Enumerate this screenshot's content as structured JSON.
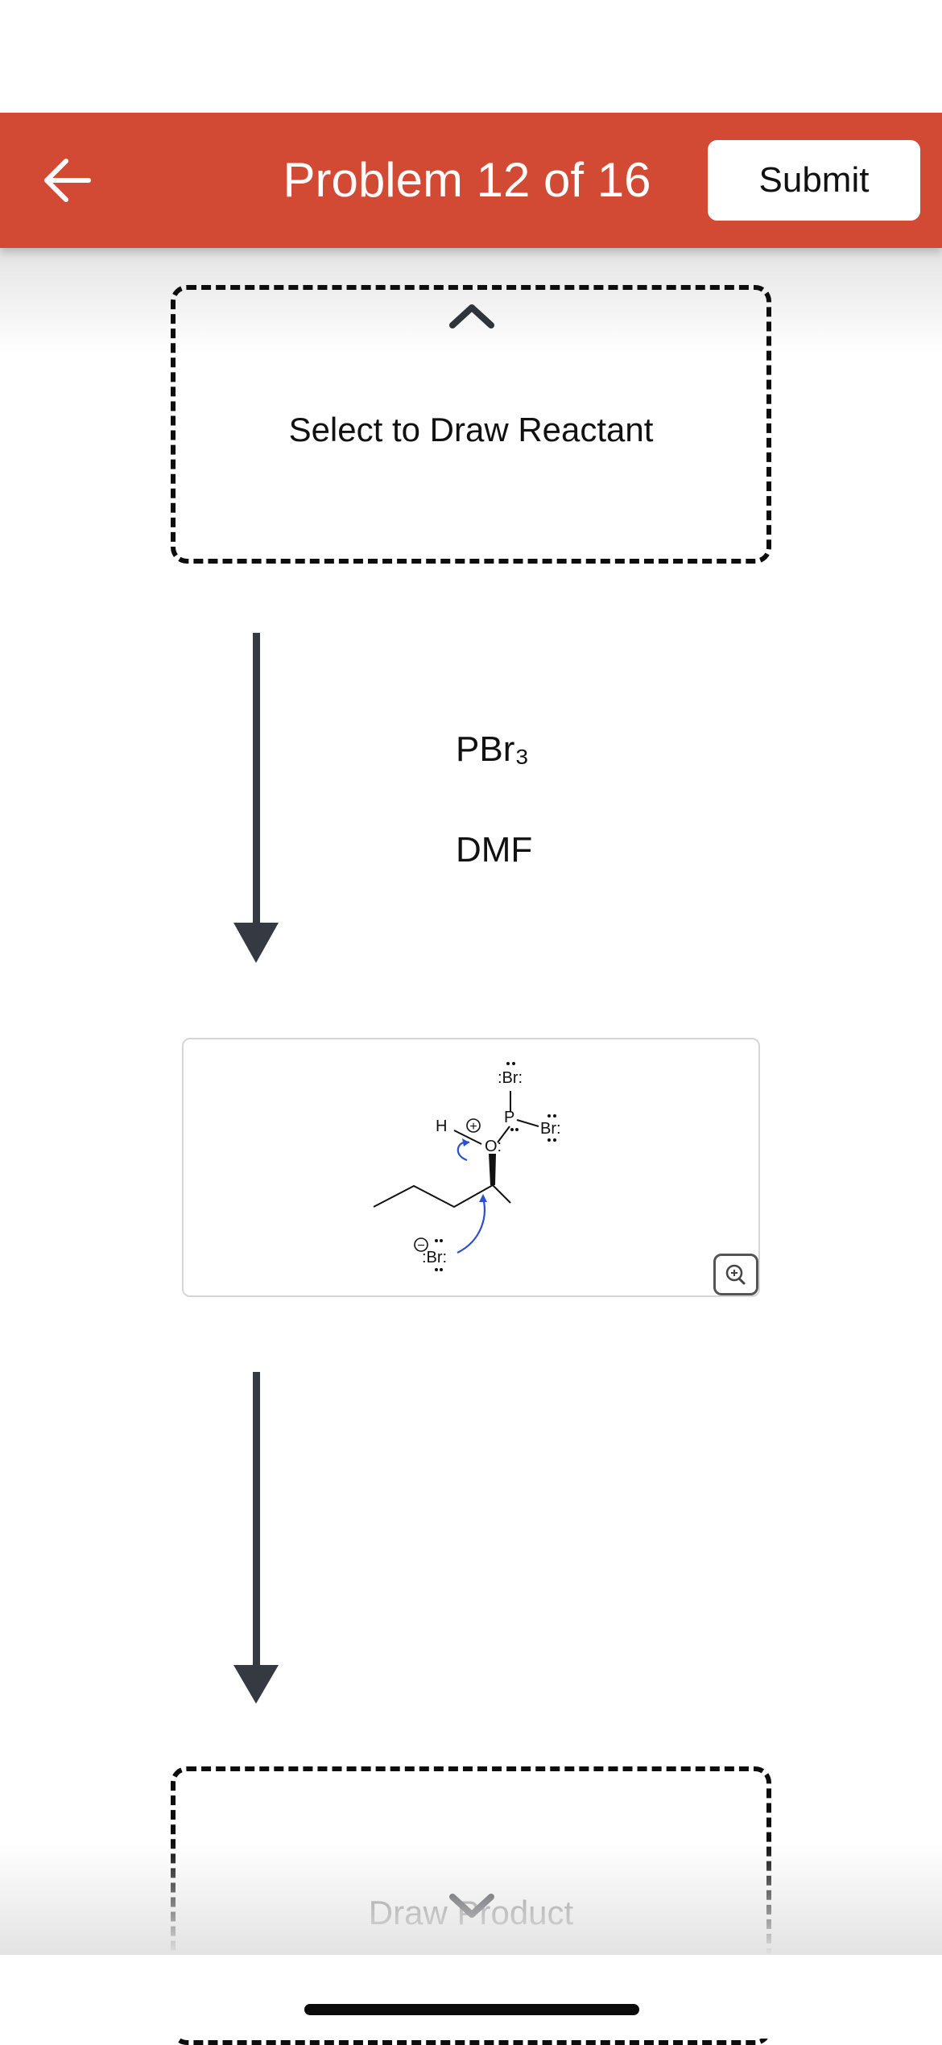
{
  "header": {
    "title": "Problem 12 of 16",
    "submit_label": "Submit",
    "accent_color": "#d24a34",
    "back_icon": "arrow-left-icon"
  },
  "reactant_box": {
    "label": "Select to Draw Reactant",
    "icon": "chevron-up-icon"
  },
  "reagents": [
    "PBr₃",
    "DMF"
  ],
  "mechanism": {
    "atoms": {
      "br_top": ":Br:",
      "p": "P",
      "br_right": "Br:",
      "o": "O:",
      "h": "H",
      "br_anion": ":Br:"
    },
    "charges": {
      "oxonium": "+",
      "bromide": "−"
    },
    "zoom_icon": "zoom-in-icon",
    "curved_arrow_color": "#2a4fd0"
  },
  "product_box": {
    "label": "Draw Product",
    "icon": "chevron-down-icon"
  }
}
